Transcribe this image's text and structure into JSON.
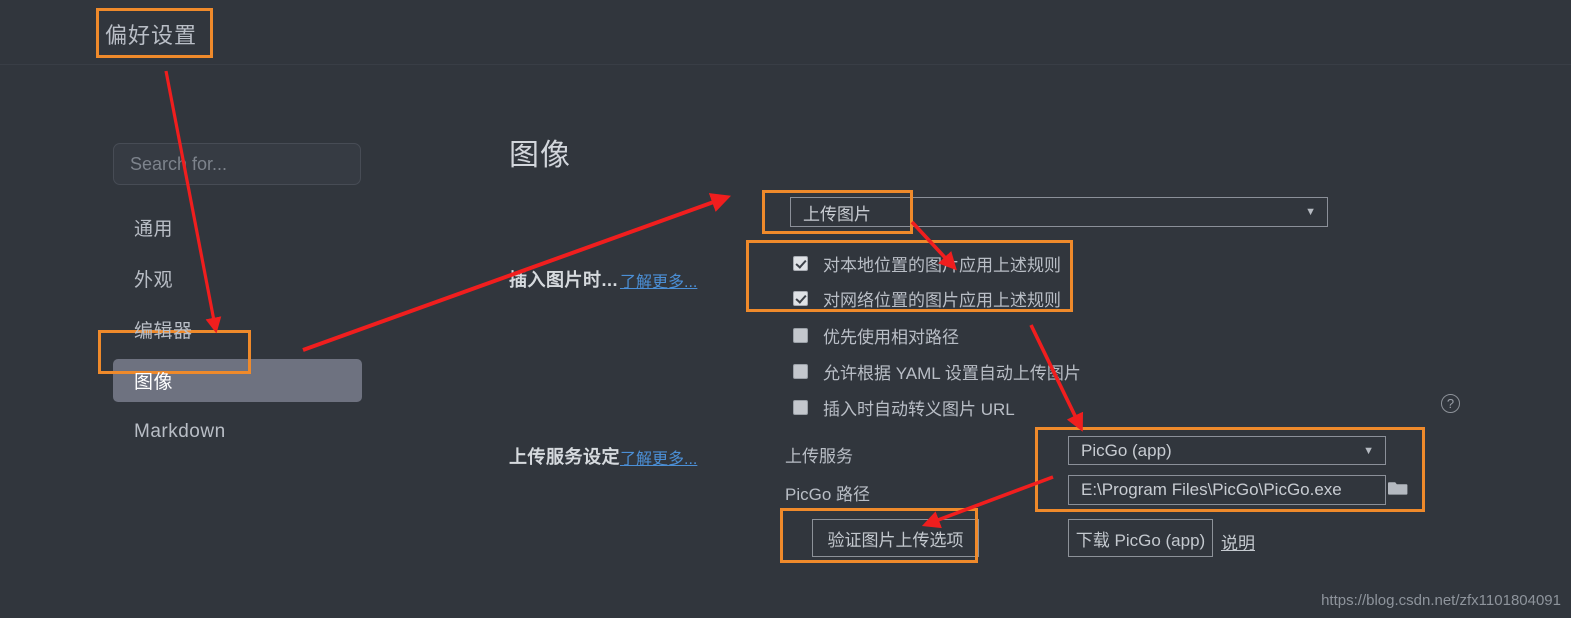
{
  "window": {
    "title": "偏好设置"
  },
  "sidebar": {
    "search": {
      "placeholder": "Search for...",
      "value": ""
    },
    "items": [
      {
        "label": "通用",
        "selected": false
      },
      {
        "label": "外观",
        "selected": false
      },
      {
        "label": "编辑器",
        "selected": false
      },
      {
        "label": "图像",
        "selected": true
      },
      {
        "label": "Markdown",
        "selected": false
      }
    ]
  },
  "main": {
    "page_title": "图像",
    "section_insert": {
      "label": "插入图片时...",
      "learn_more": "了解更多...",
      "action_select": {
        "value": "上传图片",
        "caret": "▼"
      },
      "checkboxes": [
        {
          "label": "对本地位置的图片应用上述规则",
          "checked": true
        },
        {
          "label": "对网络位置的图片应用上述规则",
          "checked": true
        },
        {
          "label": "优先使用相对路径",
          "checked": false
        },
        {
          "label": "允许根据 YAML 设置自动上传图片",
          "checked": false
        },
        {
          "label": "插入时自动转义图片 URL",
          "checked": false
        }
      ],
      "help_icon": "?"
    },
    "section_upload": {
      "label": "上传服务设定",
      "learn_more": "了解更多...",
      "service_label": "上传服务",
      "service_select": {
        "value": "PicGo (app)",
        "caret": "▼"
      },
      "path_label": "PicGo 路径",
      "path_input": {
        "value": "E:\\Program Files\\PicGo\\PicGo.exe"
      },
      "folder_icon": "folder-icon",
      "verify_button": "验证图片上传选项",
      "download_button": "下载 PicGo (app)",
      "instructions_link": "说明"
    }
  },
  "annotations": {
    "highlight_color": "#ef8a2b",
    "arrow_color": "#f01e1e",
    "watermark": "https://blog.csdn.net/zfx1101804091"
  }
}
